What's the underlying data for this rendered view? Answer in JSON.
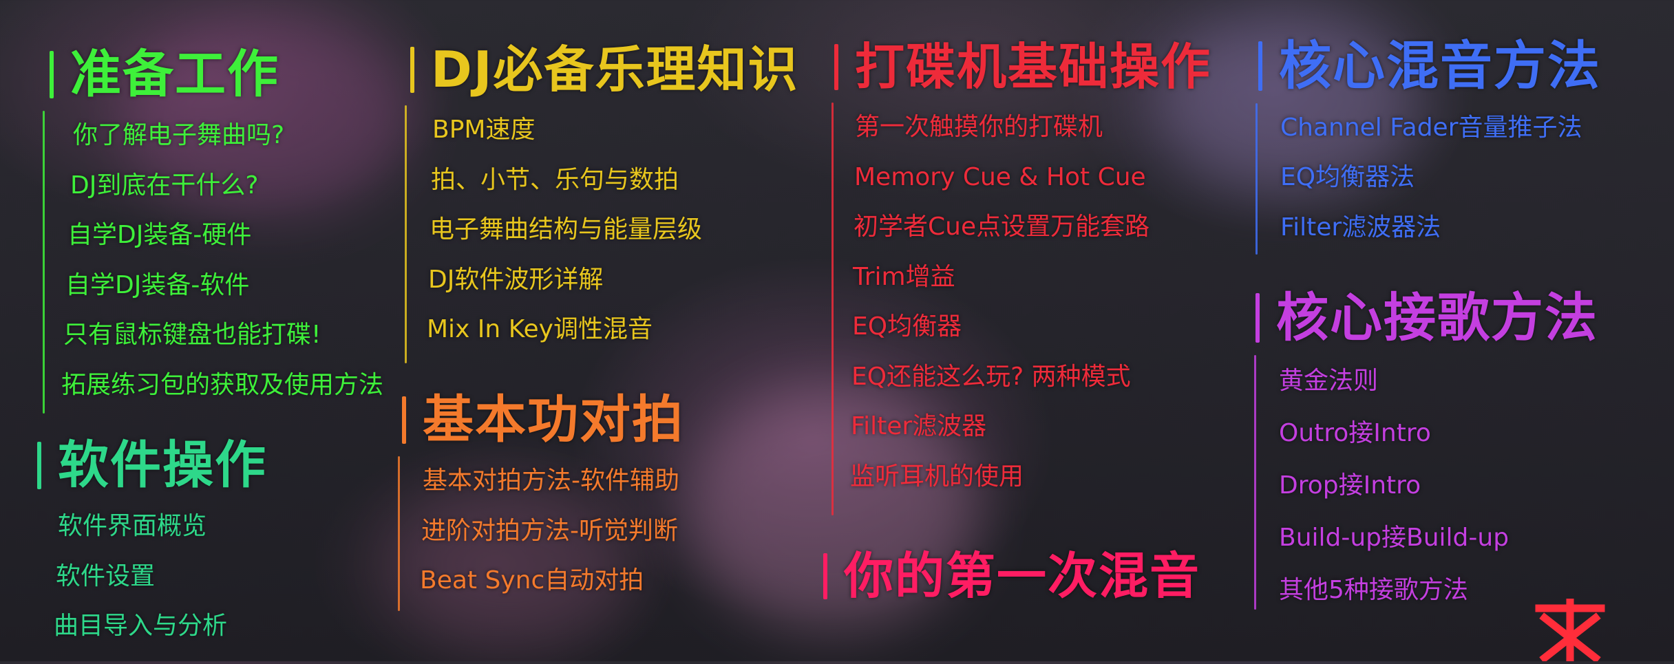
{
  "sections": {
    "prep": {
      "title": "准备工作",
      "color": "#3ef03a",
      "items": [
        "你了解电子舞曲吗?",
        "DJ到底在干什么?",
        "自学DJ装备-硬件",
        "自学DJ装备-软件",
        "只有鼠标键盘也能打碟!",
        "拓展练习包的获取及使用方法"
      ]
    },
    "software": {
      "title": "软件操作",
      "color": "#2ed88a",
      "items": [
        "软件界面概览",
        "软件设置",
        "曲目导入与分析"
      ]
    },
    "theory": {
      "title": "DJ必备乐理知识",
      "color": "#e8c61e",
      "items": [
        "BPM速度",
        "拍、小节、乐句与数拍",
        "电子舞曲结构与能量层级",
        "DJ软件波形详解",
        "Mix In Key调性混音"
      ]
    },
    "beatmatch": {
      "title": "基本功对拍",
      "color": "#f47a2c",
      "items": [
        "基本对拍方法-软件辅助",
        "进阶对拍方法-听觉判断",
        "Beat Sync自动对拍"
      ]
    },
    "controller": {
      "title": "打碟机基础操作",
      "color": "#ee2b3a",
      "items": [
        "第一次触摸你的打碟机",
        "Memory Cue & Hot Cue",
        "初学者Cue点设置万能套路",
        "Trim增益",
        "EQ均衡器",
        "EQ还能这么玩? 两种模式",
        "Filter滤波器",
        "监听耳机的使用"
      ]
    },
    "firstmix": {
      "title": "你的第一次混音",
      "color": "#ff1d63"
    },
    "mixing": {
      "title": "核心混音方法",
      "color": "#3f6ef5",
      "items": [
        "Channel Fader音量推子法",
        "EQ均衡器法",
        "Filter滤波器法"
      ]
    },
    "transition": {
      "title": "核心接歌方法",
      "color": "#c43fe0",
      "items": [
        "黄金法则",
        "Outro接Intro",
        "Drop接Intro",
        "Build-up接Build-up",
        "其他5种接歌方法"
      ]
    }
  },
  "logo": {
    "icon": "star-logo-icon",
    "color": "#ff2d3a"
  }
}
